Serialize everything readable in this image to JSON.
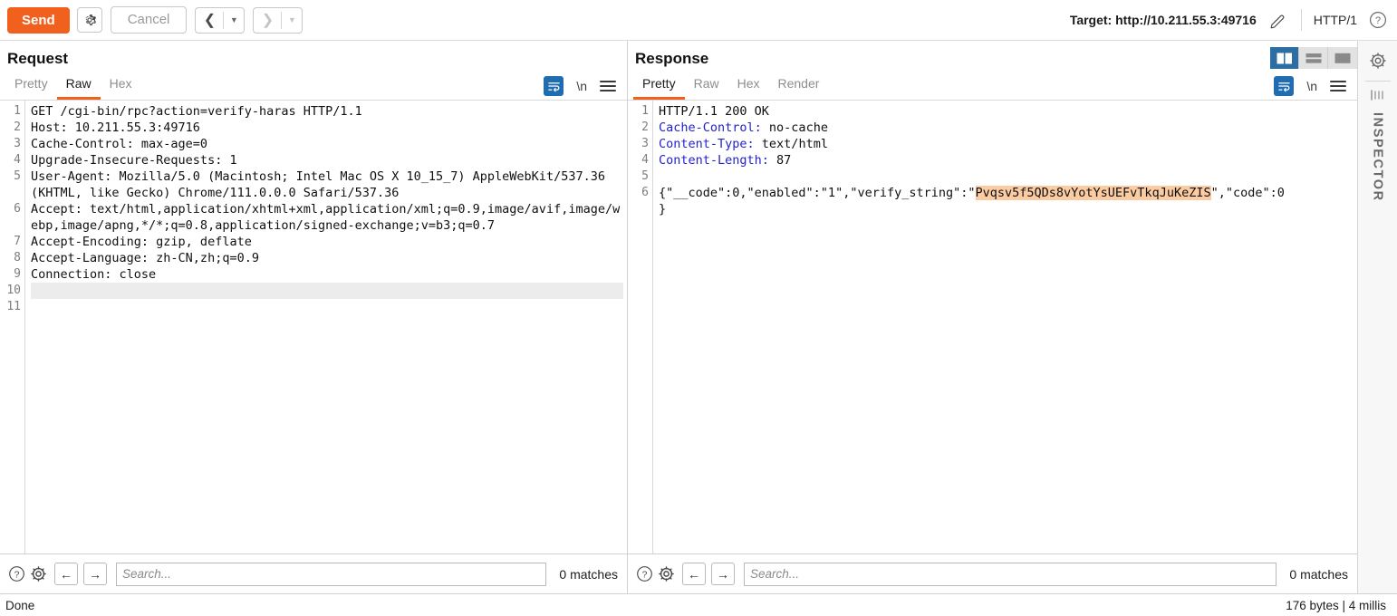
{
  "toolbar": {
    "send_label": "Send",
    "settings_icon": "gear-icon",
    "cancel_label": "Cancel",
    "prev_icon": "chevron-left-icon",
    "prev_caret": "▼",
    "next_icon": "chevron-right-icon",
    "next_caret": "▼",
    "target_label": "Target: http://10.211.55.3:49716",
    "edit_icon": "pencil-icon",
    "http_version": "HTTP/1",
    "help_icon": "question-circle-icon"
  },
  "layout_toggles": [
    {
      "name": "side-by-side",
      "active": true
    },
    {
      "name": "stacked",
      "active": false
    },
    {
      "name": "single",
      "active": false
    }
  ],
  "request": {
    "title": "Request",
    "tabs": [
      {
        "label": "Pretty",
        "active": false
      },
      {
        "label": "Raw",
        "active": true
      },
      {
        "label": "Hex",
        "active": false
      }
    ],
    "wrap_icon": "word-wrap-icon",
    "newline_label": "\\n",
    "menu_icon": "hamburger-menu-icon",
    "line_numbers": [
      "1",
      "2",
      "3",
      "4",
      "5",
      "",
      "6",
      "",
      "",
      "7",
      "8",
      "9",
      "10",
      "11"
    ],
    "lines": [
      {
        "text": "GET /cgi-bin/rpc?action=verify-haras HTTP/1.1"
      },
      {
        "text": "Host: 10.211.55.3:49716"
      },
      {
        "text": "Cache-Control: max-age=0"
      },
      {
        "text": "Upgrade-Insecure-Requests: 1"
      },
      {
        "text": "User-Agent: Mozilla/5.0 (Macintosh; Intel Mac OS X 10_15_7) AppleWebKit/537.36 (KHTML, like Gecko) Chrome/111.0.0.0 Safari/537.36"
      },
      {
        "text": "Accept: text/html,application/xhtml+xml,application/xml;q=0.9,image/avif,image/webp,image/apng,*/*;q=0.8,application/signed-exchange;v=b3;q=0.7"
      },
      {
        "text": "Accept-Encoding: gzip, deflate"
      },
      {
        "text": "Accept-Language: zh-CN,zh;q=0.9"
      },
      {
        "text": "Connection: close"
      },
      {
        "text": "",
        "cursor": true
      },
      {
        "text": ""
      }
    ],
    "search": {
      "help_icon": "question-circle-icon",
      "settings_icon": "gear-icon",
      "prev_icon": "arrow-left-icon",
      "next_icon": "arrow-right-icon",
      "placeholder": "Search...",
      "value": "",
      "matches": "0 matches"
    }
  },
  "response": {
    "title": "Response",
    "tabs": [
      {
        "label": "Pretty",
        "active": true
      },
      {
        "label": "Raw",
        "active": false
      },
      {
        "label": "Hex",
        "active": false
      },
      {
        "label": "Render",
        "active": false
      }
    ],
    "wrap_icon": "word-wrap-icon",
    "newline_label": "\\n",
    "menu_icon": "hamburger-menu-icon",
    "line_numbers": [
      "1",
      "2",
      "3",
      "4",
      "5",
      "6",
      ""
    ],
    "status_line": "HTTP/1.1 200 OK",
    "headers": [
      {
        "name": "Cache-Control",
        "value": " no-cache"
      },
      {
        "name": "Content-Type",
        "value": " text/html"
      },
      {
        "name": "Content-Length",
        "value": " 87"
      }
    ],
    "body_prefix": "{\"__code\":0,\"enabled\":\"1\",\"verify_string\":\"",
    "body_highlight": "Pvqsv5f5QDs8vYotYsUEFvTkqJuKeZIS",
    "body_suffix": "\",\"code\":0",
    "body_close": "}",
    "search": {
      "help_icon": "question-circle-icon",
      "settings_icon": "gear-icon",
      "prev_icon": "arrow-left-icon",
      "next_icon": "arrow-right-icon",
      "placeholder": "Search...",
      "value": "",
      "matches": "0 matches"
    }
  },
  "rail": {
    "gear_icon": "gear-icon",
    "collapse_icon": "collapse-panel-icon",
    "inspector_label": "INSPECTOR"
  },
  "statusbar": {
    "left": "Done",
    "right": "176 bytes | 4 millis"
  },
  "colors": {
    "accent_orange": "#f2601e",
    "accent_blue": "#1f6cb0",
    "header_blue": "#2222cc",
    "highlight": "#fbcba2"
  }
}
